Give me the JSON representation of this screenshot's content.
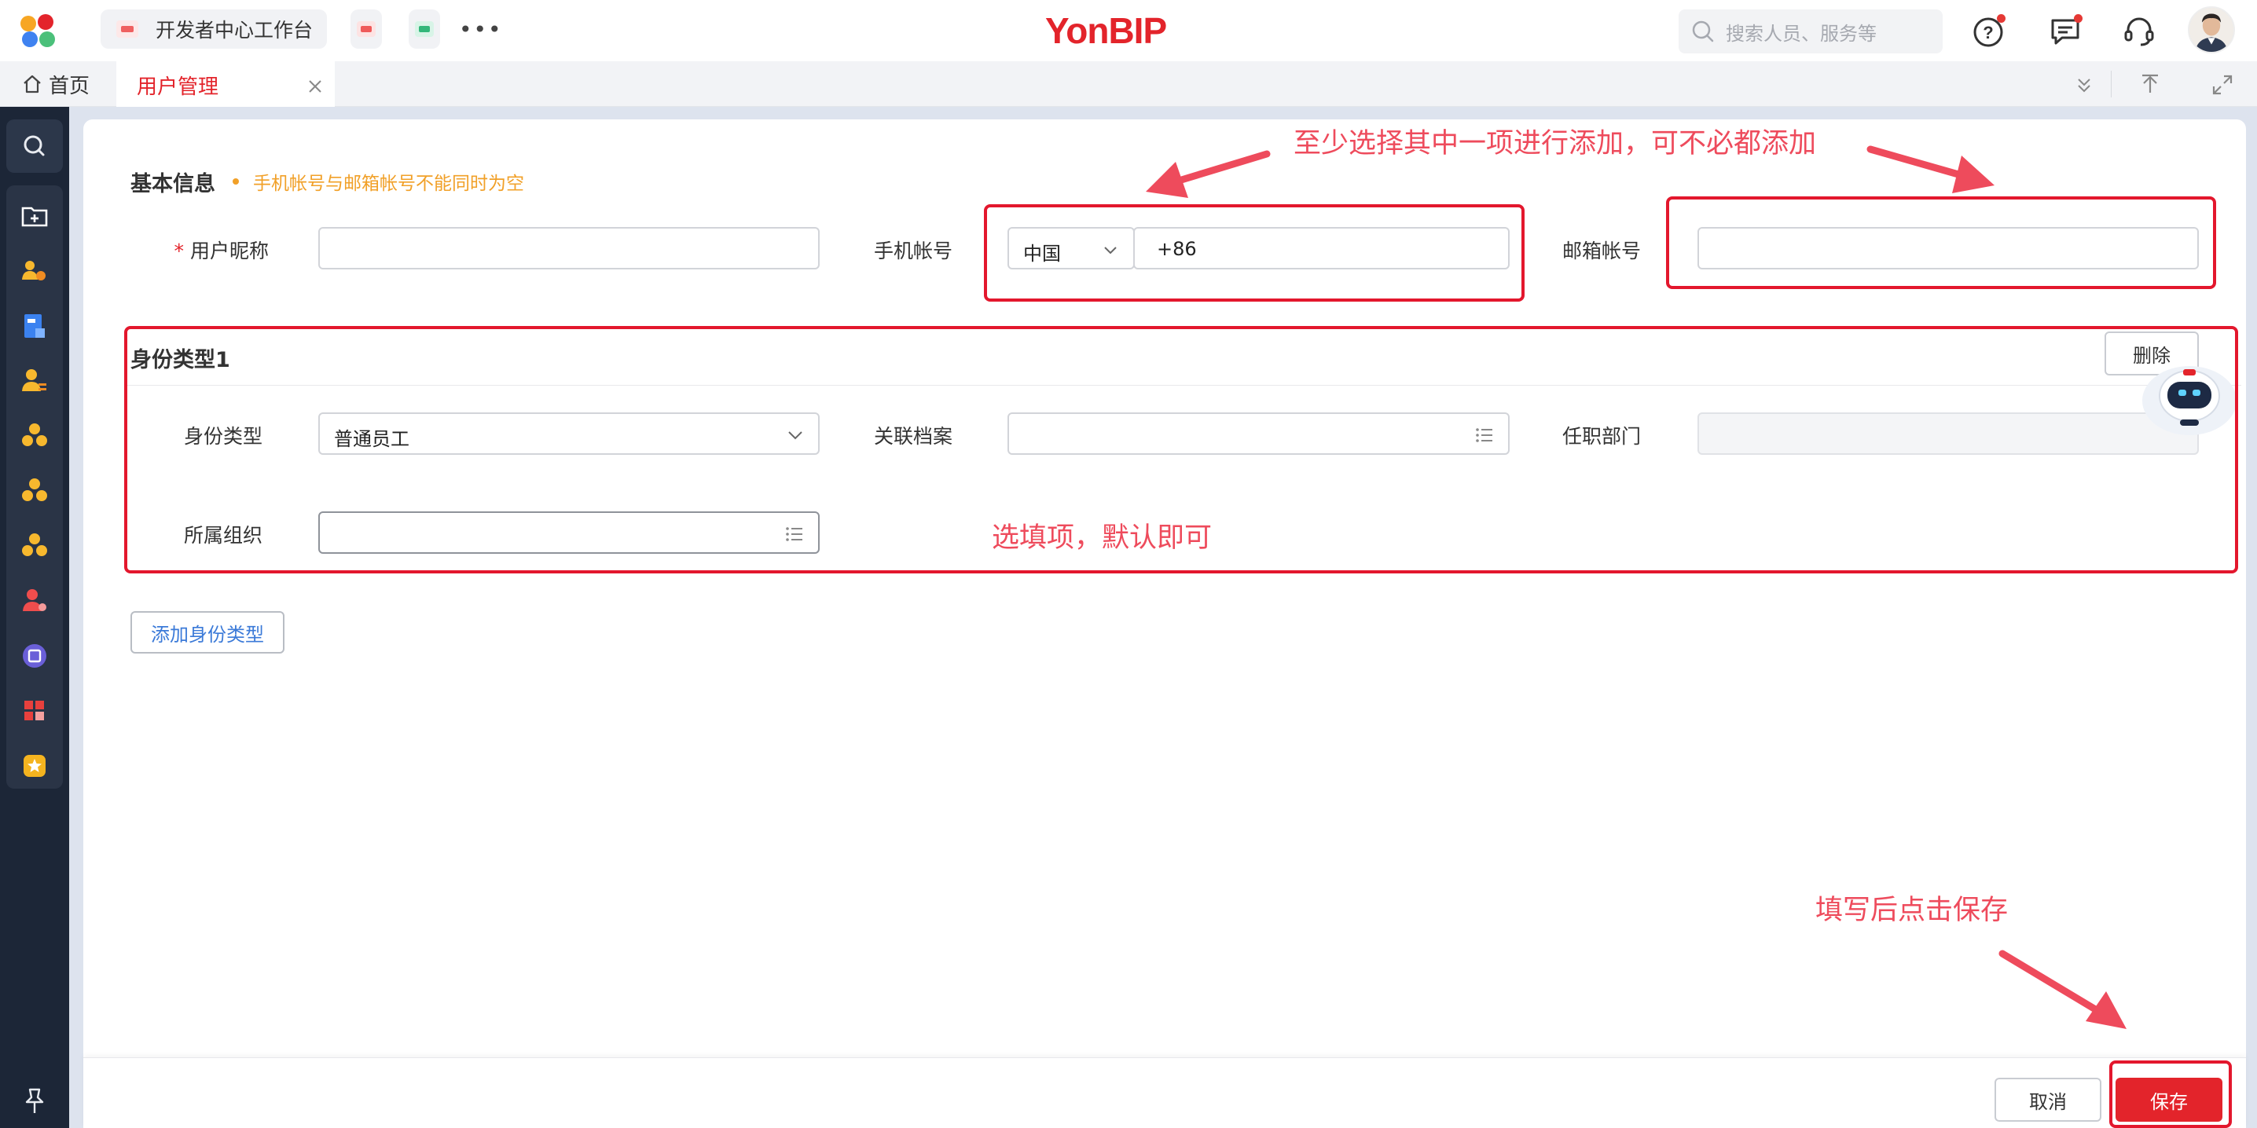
{
  "header": {
    "brand": "YonBIP",
    "app_tab_title": "开发者中心工作台",
    "search_placeholder": "搜索人员、服务等"
  },
  "tabs": {
    "home_label": "首页",
    "active_label": "用户管理"
  },
  "form": {
    "basic_section_title": "基本信息",
    "basic_hint": "手机帐号与邮箱帐号不能同时为空",
    "nickname_label": "用户昵称",
    "phone_label": "手机帐号",
    "phone_country": "中国",
    "phone_prefix": "+86",
    "email_label": "邮箱帐号",
    "identity_section_title": "身份类型1",
    "delete_label": "删除",
    "identity_type_label": "身份类型",
    "identity_type_value": "普通员工",
    "linked_profile_label": "关联档案",
    "department_label": "任职部门",
    "organization_label": "所属组织",
    "add_identity_label": "添加身份类型"
  },
  "footer": {
    "cancel_label": "取消",
    "save_label": "保存"
  },
  "annotations": {
    "top_note": "至少选择其中一项进行添加，可不必都添加",
    "optional_note": "选填项，默认即可",
    "save_note": "填写后点击保存"
  },
  "colors": {
    "brand_red": "#e3242b",
    "annotation_red": "#ee4b5c",
    "hint_orange": "#f1a028",
    "rail_dark": "#1c2637",
    "link_blue": "#3b7ad8"
  }
}
